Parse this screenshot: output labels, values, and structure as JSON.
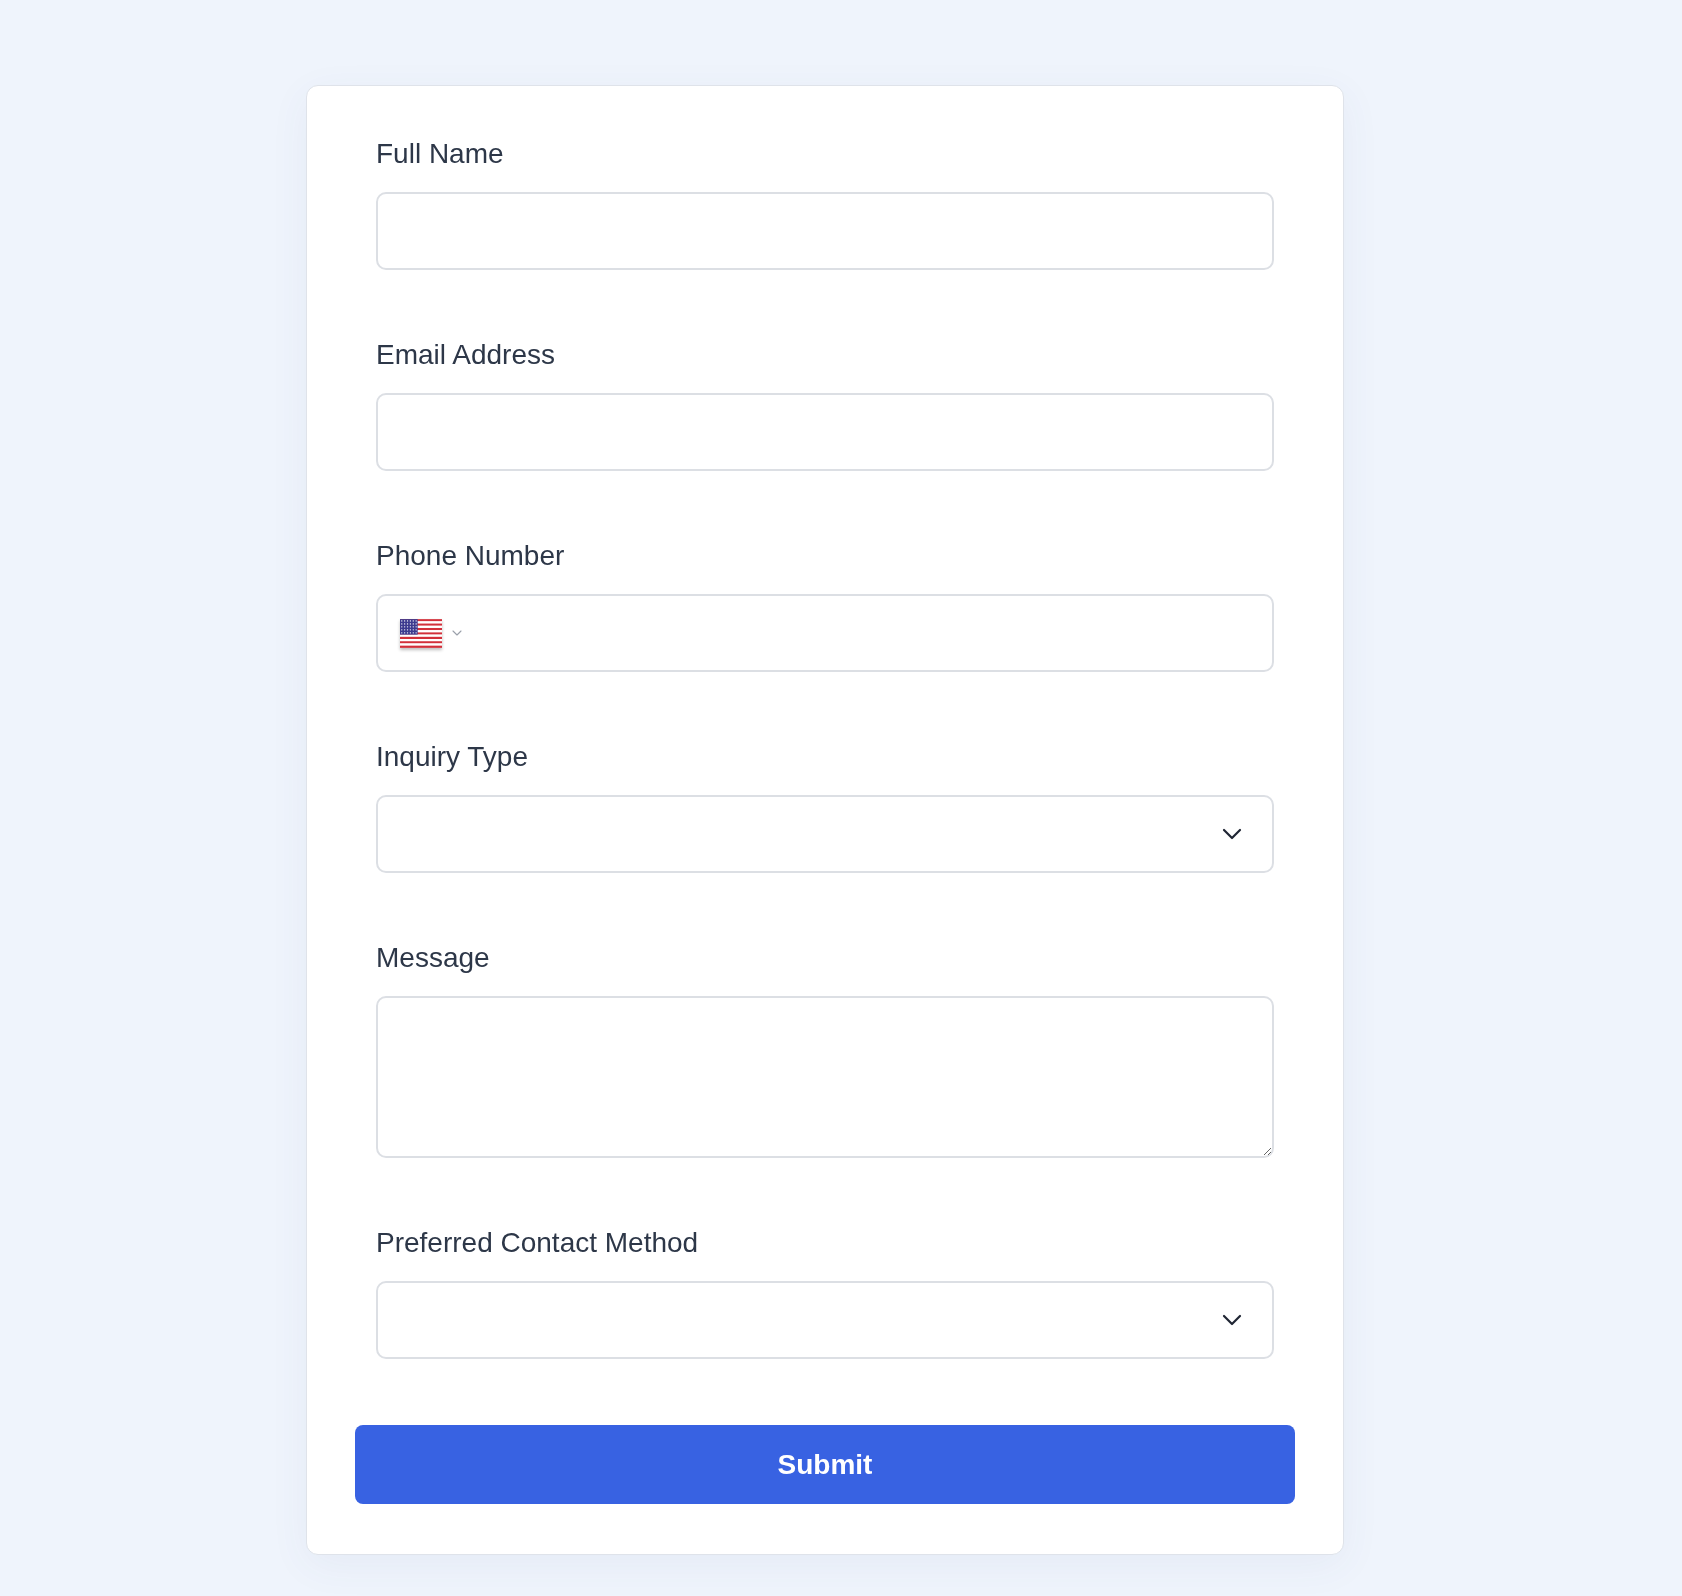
{
  "form": {
    "fields": [
      {
        "kind": "text",
        "label": "Full Name"
      },
      {
        "kind": "text",
        "label": "Email Address"
      },
      {
        "kind": "phone",
        "label": "Phone Number"
      },
      {
        "kind": "select",
        "label": "Inquiry Type"
      },
      {
        "kind": "textarea",
        "label": "Message"
      },
      {
        "kind": "select",
        "label": "Preferred Contact Method"
      }
    ],
    "submit": "Submit"
  }
}
